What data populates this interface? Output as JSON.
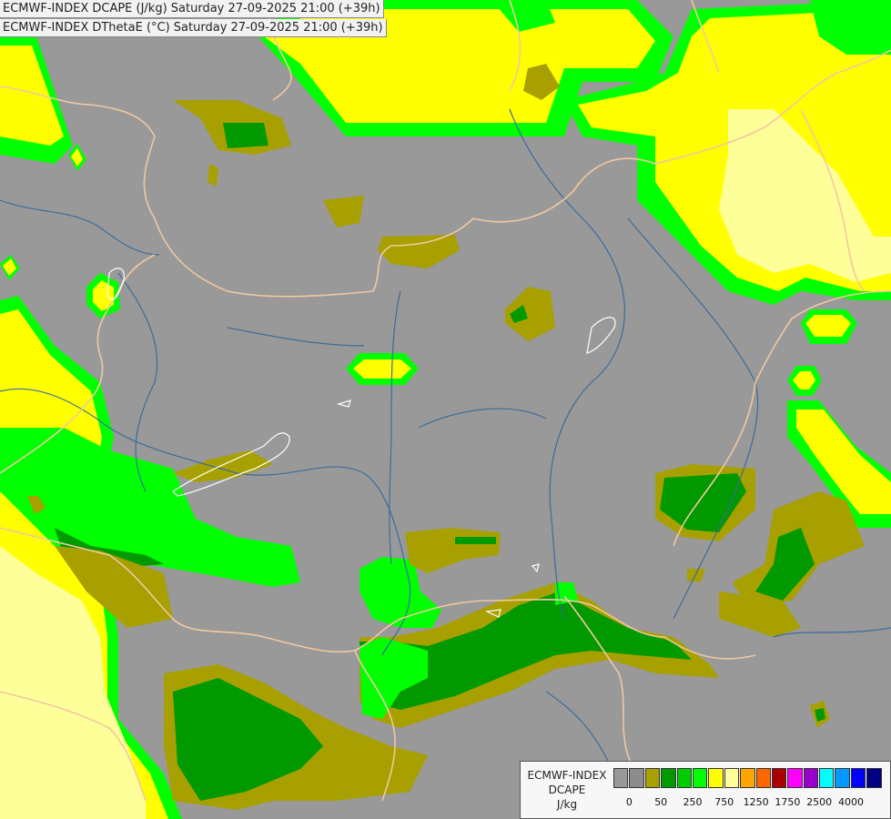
{
  "header": {
    "line1": "ECMWF-INDEX DCAPE (J/kg) Saturday 27-09-2025 21:00 (+39h)",
    "line2": "ECMWF-INDEX DThetaE (°C) Saturday 27-09-2025 21:00 (+39h)"
  },
  "legend": {
    "line1": "ECMWF-INDEX",
    "line2": "DCAPE",
    "line3": "J/kg",
    "colors": [
      "#999999",
      "#8c8c8c",
      "#a8a000",
      "#009900",
      "#00cc00",
      "#00ff00",
      "#ffff00",
      "#ffff99",
      "#ffa500",
      "#ff6600",
      "#aa0000",
      "#ff00ff",
      "#9900cc",
      "#00ffff",
      "#0099ff",
      "#0000ff",
      "#000080"
    ],
    "ticks": [
      {
        "label": "0",
        "slot": 1
      },
      {
        "label": "50",
        "slot": 3
      },
      {
        "label": "250",
        "slot": 5
      },
      {
        "label": "750",
        "slot": 7
      },
      {
        "label": "1250",
        "slot": 9
      },
      {
        "label": "1750",
        "slot": 11
      },
      {
        "label": "2500",
        "slot": 13
      },
      {
        "label": "4000",
        "slot": 15
      }
    ]
  },
  "map": {
    "background": "#999999",
    "border_color": "#f0c8a0",
    "river_color": "#3c6c9c",
    "lake_outline": "#ffffff",
    "field_colors": {
      "olive": "#a8a000",
      "dark_green": "#009900",
      "green": "#00ff00",
      "yellow": "#ffff00",
      "pale_yellow": "#ffff99"
    }
  }
}
